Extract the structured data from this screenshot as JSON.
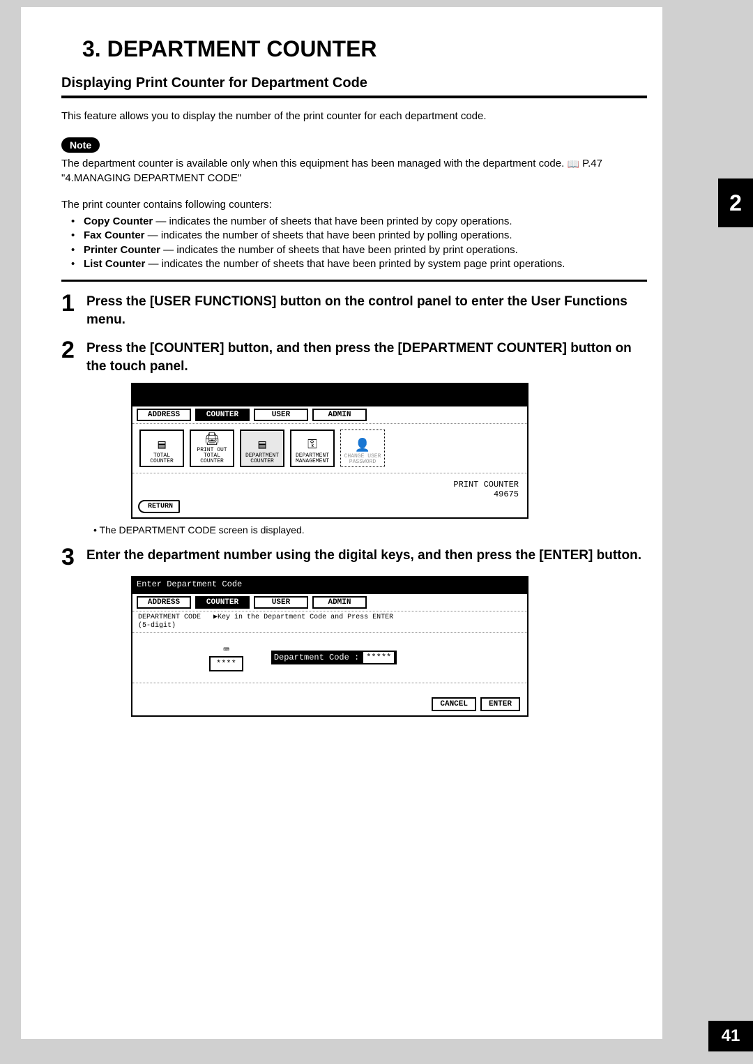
{
  "chapter_title": "3. DEPARTMENT COUNTER",
  "section_heading": "Displaying Print Counter for Department Code",
  "intro": "This feature allows you to display the number of the print counter for each department code.",
  "note_label": "Note",
  "note_text_1": "The department counter is available only when this equipment has been managed with the department code. ",
  "note_ref": " P.47 \"4.MANAGING DEPARTMENT CODE\"",
  "counters_intro": "The print counter contains following counters:",
  "counters": [
    {
      "name": "Copy Counter",
      "desc": " — indicates the number of sheets that have been printed by copy operations."
    },
    {
      "name": "Fax Counter",
      "desc": " — indicates the number of sheets that have been printed by polling operations."
    },
    {
      "name": "Printer Counter",
      "desc": " — indicates the number of sheets that have been printed by print operations."
    },
    {
      "name": "List Counter",
      "desc": " — indicates the number of sheets that have been printed by system page print operations."
    }
  ],
  "steps": [
    {
      "num": "1",
      "text": "Press the [USER FUNCTIONS] button on the control panel to enter the User Functions menu."
    },
    {
      "num": "2",
      "text": "Press the [COUNTER] button, and then press the [DEPARTMENT COUNTER] button on the touch panel."
    },
    {
      "num": "3",
      "text": "Enter the department number using the digital keys, and then press the [ENTER] button."
    }
  ],
  "step2_sub": "• The DEPARTMENT CODE screen is displayed.",
  "screenshot1": {
    "tabs": [
      "ADDRESS",
      "COUNTER",
      "USER",
      "ADMIN"
    ],
    "active_tab": 1,
    "icons": [
      "TOTAL COUNTER",
      "PRINT OUT TOTAL COUNTER",
      "DEPARTMENT COUNTER",
      "DEPARTMENT MANAGEMENT",
      "CHANGE USER PASSWORD"
    ],
    "selected_icon": 2,
    "print_counter_label": "PRINT COUNTER",
    "print_counter_value": "49675",
    "return": "RETURN"
  },
  "screenshot2": {
    "header": "Enter Department Code",
    "tabs": [
      "ADDRESS",
      "COUNTER",
      "USER",
      "ADMIN"
    ],
    "active_tab": 1,
    "instruction_label": "DEPARTMENT CODE",
    "instruction_sub": "(5-digit)",
    "instruction_text": "▶Key in the Department Code and Press ENTER",
    "keypad_value": "****",
    "dept_code_label": "Department Code :",
    "dept_code_value": "*****",
    "cancel": "CANCEL",
    "enter": "ENTER"
  },
  "side_tab": "2",
  "page_number": "41"
}
